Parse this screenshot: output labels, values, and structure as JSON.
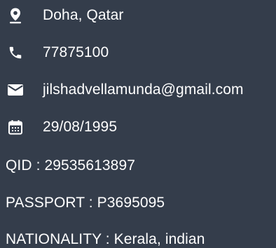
{
  "contact": {
    "location": {
      "icon": "location-pin-icon",
      "text": "Doha, Qatar"
    },
    "phone": {
      "icon": "phone-icon",
      "text": "77875100"
    },
    "email": {
      "icon": "mail-icon",
      "text": "jilshadvellamunda@gmail.com"
    },
    "dob": {
      "icon": "calendar-icon",
      "text": "29/08/1995"
    }
  },
  "details": {
    "qid": "QID : 29535613897",
    "passport": "PASSPORT : P3695095",
    "nationality": "NATIONALITY : Kerala, indian"
  },
  "colors": {
    "background": "#343d4b",
    "text": "#ffffff"
  }
}
